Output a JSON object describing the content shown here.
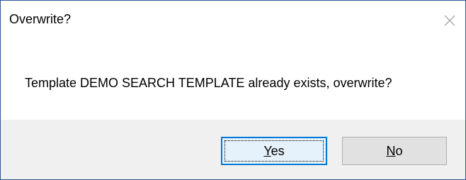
{
  "dialog": {
    "title": "Overwrite?",
    "close_icon": "close-icon",
    "message": "Template DEMO SEARCH TEMPLATE already exists, overwrite?",
    "buttons": {
      "yes": {
        "accel": "Y",
        "rest": "es"
      },
      "no": {
        "accel": "N",
        "rest": "o"
      }
    }
  },
  "colors": {
    "border": "#2b5797",
    "footer_bg": "#f0f0f0",
    "button_bg": "#e1e1e1",
    "default_button_border": "#0078d7",
    "default_button_bg": "#e5f1fb"
  }
}
